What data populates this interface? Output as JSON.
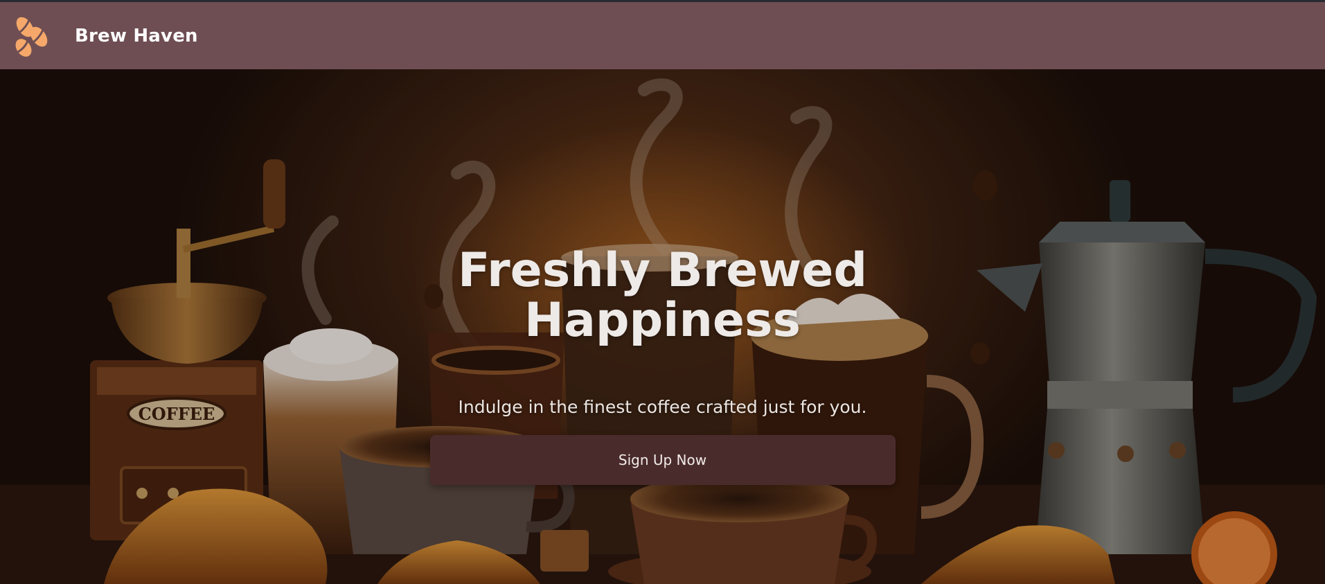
{
  "header": {
    "brand_name": "Brew Haven",
    "logo_icon": "coffee-beans-icon",
    "background_color": "#6e4e53",
    "logo_color": "#f5a86a"
  },
  "hero": {
    "headline": "Freshly Brewed Happiness",
    "subtitle": "Indulge in the finest coffee crafted just for you.",
    "cta_label": "Sign Up Now",
    "cta_color": "#4a2b2b",
    "grinder_label": "COFFEE"
  }
}
